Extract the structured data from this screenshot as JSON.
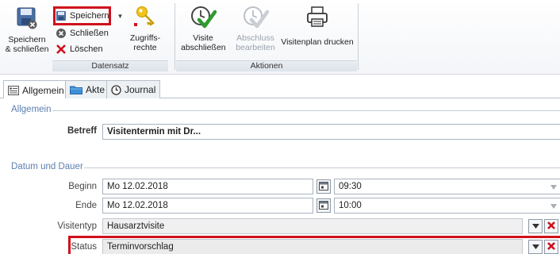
{
  "ribbon": {
    "save_close_label": "Speichern & schließen",
    "save_label": "Speichern",
    "close_label": "Schließen",
    "delete_label": "Löschen",
    "access_rights_label": "Zugriffs-rechte",
    "group_record_label": "Datensatz",
    "visit_finish_label": "Visite abschließen",
    "edit_completion_label": "Abschluss bearbeiten",
    "print_plan_label": "Visitenplan drucken",
    "group_actions_label": "Aktionen"
  },
  "tabs": [
    {
      "label": "Allgemein",
      "icon": "form-icon",
      "active": true
    },
    {
      "label": "Akte",
      "icon": "folder-icon",
      "active": false
    },
    {
      "label": "Journal",
      "icon": "clock-icon",
      "active": false
    }
  ],
  "form": {
    "section_general": "Allgemein",
    "subject_label": "Betreff",
    "subject_value": "Visitentermin mit Dr...",
    "section_date": "Datum und Dauer",
    "start_label": "Beginn",
    "start_date": "Mo 12.02.2018",
    "start_time": "09:30",
    "end_label": "Ende",
    "end_date": "Mo 12.02.2018",
    "end_time": "10:00",
    "visit_type_label": "Visitentyp",
    "visit_type_value": "Hausarztvisite",
    "status_label": "Status",
    "status_value": "Terminvorschlag"
  },
  "colors": {
    "highlight": "#d0101c",
    "section_title": "#5d7fb0",
    "check_green": "#2e9b2e"
  }
}
